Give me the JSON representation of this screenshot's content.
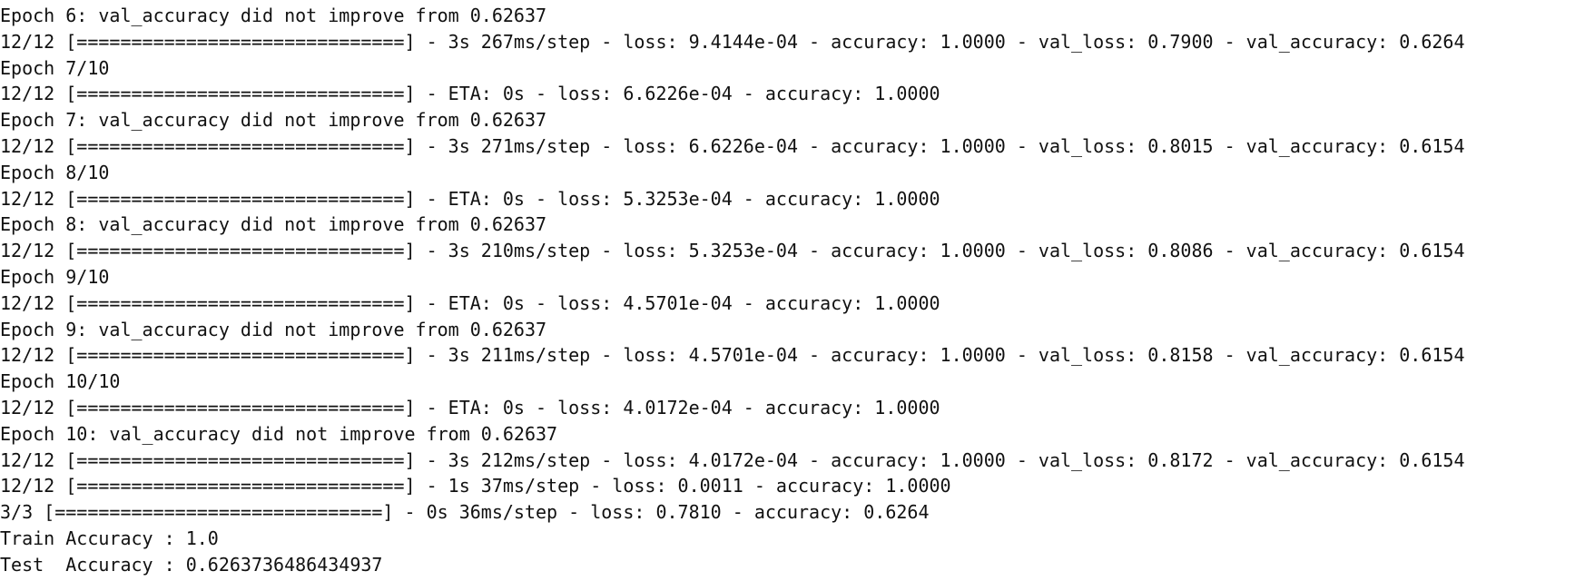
{
  "output": {
    "lines": [
      "Epoch 6: val_accuracy did not improve from 0.62637",
      "12/12 [==============================] - 3s 267ms/step - loss: 9.4144e-04 - accuracy: 1.0000 - val_loss: 0.7900 - val_accuracy: 0.6264",
      "Epoch 7/10",
      "12/12 [==============================] - ETA: 0s - loss: 6.6226e-04 - accuracy: 1.0000",
      "Epoch 7: val_accuracy did not improve from 0.62637",
      "12/12 [==============================] - 3s 271ms/step - loss: 6.6226e-04 - accuracy: 1.0000 - val_loss: 0.8015 - val_accuracy: 0.6154",
      "Epoch 8/10",
      "12/12 [==============================] - ETA: 0s - loss: 5.3253e-04 - accuracy: 1.0000",
      "Epoch 8: val_accuracy did not improve from 0.62637",
      "12/12 [==============================] - 3s 210ms/step - loss: 5.3253e-04 - accuracy: 1.0000 - val_loss: 0.8086 - val_accuracy: 0.6154",
      "Epoch 9/10",
      "12/12 [==============================] - ETA: 0s - loss: 4.5701e-04 - accuracy: 1.0000",
      "Epoch 9: val_accuracy did not improve from 0.62637",
      "12/12 [==============================] - 3s 211ms/step - loss: 4.5701e-04 - accuracy: 1.0000 - val_loss: 0.8158 - val_accuracy: 0.6154",
      "Epoch 10/10",
      "12/12 [==============================] - ETA: 0s - loss: 4.0172e-04 - accuracy: 1.0000",
      "Epoch 10: val_accuracy did not improve from 0.62637",
      "12/12 [==============================] - 3s 212ms/step - loss: 4.0172e-04 - accuracy: 1.0000 - val_loss: 0.8172 - val_accuracy: 0.6154",
      "12/12 [==============================] - 1s 37ms/step - loss: 0.0011 - accuracy: 1.0000",
      "3/3 [==============================] - 0s 36ms/step - loss: 0.7810 - accuracy: 0.6264",
      "Train Accuracy : 1.0",
      "Test  Accuracy : 0.6263736486434937"
    ]
  },
  "colors": {
    "background": "#ffffff",
    "text": "#111111"
  }
}
